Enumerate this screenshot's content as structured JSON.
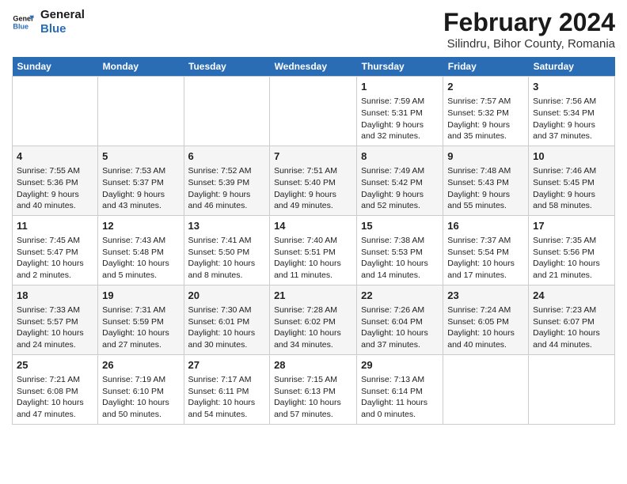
{
  "logo": {
    "line1": "General",
    "line2": "Blue"
  },
  "title": "February 2024",
  "subtitle": "Silindru, Bihor County, Romania",
  "days_header": [
    "Sunday",
    "Monday",
    "Tuesday",
    "Wednesday",
    "Thursday",
    "Friday",
    "Saturday"
  ],
  "weeks": [
    [
      {
        "day": "",
        "content": ""
      },
      {
        "day": "",
        "content": ""
      },
      {
        "day": "",
        "content": ""
      },
      {
        "day": "",
        "content": ""
      },
      {
        "day": "1",
        "content": "Sunrise: 7:59 AM\nSunset: 5:31 PM\nDaylight: 9 hours\nand 32 minutes."
      },
      {
        "day": "2",
        "content": "Sunrise: 7:57 AM\nSunset: 5:32 PM\nDaylight: 9 hours\nand 35 minutes."
      },
      {
        "day": "3",
        "content": "Sunrise: 7:56 AM\nSunset: 5:34 PM\nDaylight: 9 hours\nand 37 minutes."
      }
    ],
    [
      {
        "day": "4",
        "content": "Sunrise: 7:55 AM\nSunset: 5:36 PM\nDaylight: 9 hours\nand 40 minutes."
      },
      {
        "day": "5",
        "content": "Sunrise: 7:53 AM\nSunset: 5:37 PM\nDaylight: 9 hours\nand 43 minutes."
      },
      {
        "day": "6",
        "content": "Sunrise: 7:52 AM\nSunset: 5:39 PM\nDaylight: 9 hours\nand 46 minutes."
      },
      {
        "day": "7",
        "content": "Sunrise: 7:51 AM\nSunset: 5:40 PM\nDaylight: 9 hours\nand 49 minutes."
      },
      {
        "day": "8",
        "content": "Sunrise: 7:49 AM\nSunset: 5:42 PM\nDaylight: 9 hours\nand 52 minutes."
      },
      {
        "day": "9",
        "content": "Sunrise: 7:48 AM\nSunset: 5:43 PM\nDaylight: 9 hours\nand 55 minutes."
      },
      {
        "day": "10",
        "content": "Sunrise: 7:46 AM\nSunset: 5:45 PM\nDaylight: 9 hours\nand 58 minutes."
      }
    ],
    [
      {
        "day": "11",
        "content": "Sunrise: 7:45 AM\nSunset: 5:47 PM\nDaylight: 10 hours\nand 2 minutes."
      },
      {
        "day": "12",
        "content": "Sunrise: 7:43 AM\nSunset: 5:48 PM\nDaylight: 10 hours\nand 5 minutes."
      },
      {
        "day": "13",
        "content": "Sunrise: 7:41 AM\nSunset: 5:50 PM\nDaylight: 10 hours\nand 8 minutes."
      },
      {
        "day": "14",
        "content": "Sunrise: 7:40 AM\nSunset: 5:51 PM\nDaylight: 10 hours\nand 11 minutes."
      },
      {
        "day": "15",
        "content": "Sunrise: 7:38 AM\nSunset: 5:53 PM\nDaylight: 10 hours\nand 14 minutes."
      },
      {
        "day": "16",
        "content": "Sunrise: 7:37 AM\nSunset: 5:54 PM\nDaylight: 10 hours\nand 17 minutes."
      },
      {
        "day": "17",
        "content": "Sunrise: 7:35 AM\nSunset: 5:56 PM\nDaylight: 10 hours\nand 21 minutes."
      }
    ],
    [
      {
        "day": "18",
        "content": "Sunrise: 7:33 AM\nSunset: 5:57 PM\nDaylight: 10 hours\nand 24 minutes."
      },
      {
        "day": "19",
        "content": "Sunrise: 7:31 AM\nSunset: 5:59 PM\nDaylight: 10 hours\nand 27 minutes."
      },
      {
        "day": "20",
        "content": "Sunrise: 7:30 AM\nSunset: 6:01 PM\nDaylight: 10 hours\nand 30 minutes."
      },
      {
        "day": "21",
        "content": "Sunrise: 7:28 AM\nSunset: 6:02 PM\nDaylight: 10 hours\nand 34 minutes."
      },
      {
        "day": "22",
        "content": "Sunrise: 7:26 AM\nSunset: 6:04 PM\nDaylight: 10 hours\nand 37 minutes."
      },
      {
        "day": "23",
        "content": "Sunrise: 7:24 AM\nSunset: 6:05 PM\nDaylight: 10 hours\nand 40 minutes."
      },
      {
        "day": "24",
        "content": "Sunrise: 7:23 AM\nSunset: 6:07 PM\nDaylight: 10 hours\nand 44 minutes."
      }
    ],
    [
      {
        "day": "25",
        "content": "Sunrise: 7:21 AM\nSunset: 6:08 PM\nDaylight: 10 hours\nand 47 minutes."
      },
      {
        "day": "26",
        "content": "Sunrise: 7:19 AM\nSunset: 6:10 PM\nDaylight: 10 hours\nand 50 minutes."
      },
      {
        "day": "27",
        "content": "Sunrise: 7:17 AM\nSunset: 6:11 PM\nDaylight: 10 hours\nand 54 minutes."
      },
      {
        "day": "28",
        "content": "Sunrise: 7:15 AM\nSunset: 6:13 PM\nDaylight: 10 hours\nand 57 minutes."
      },
      {
        "day": "29",
        "content": "Sunrise: 7:13 AM\nSunset: 6:14 PM\nDaylight: 11 hours\nand 0 minutes."
      },
      {
        "day": "",
        "content": ""
      },
      {
        "day": "",
        "content": ""
      }
    ]
  ]
}
